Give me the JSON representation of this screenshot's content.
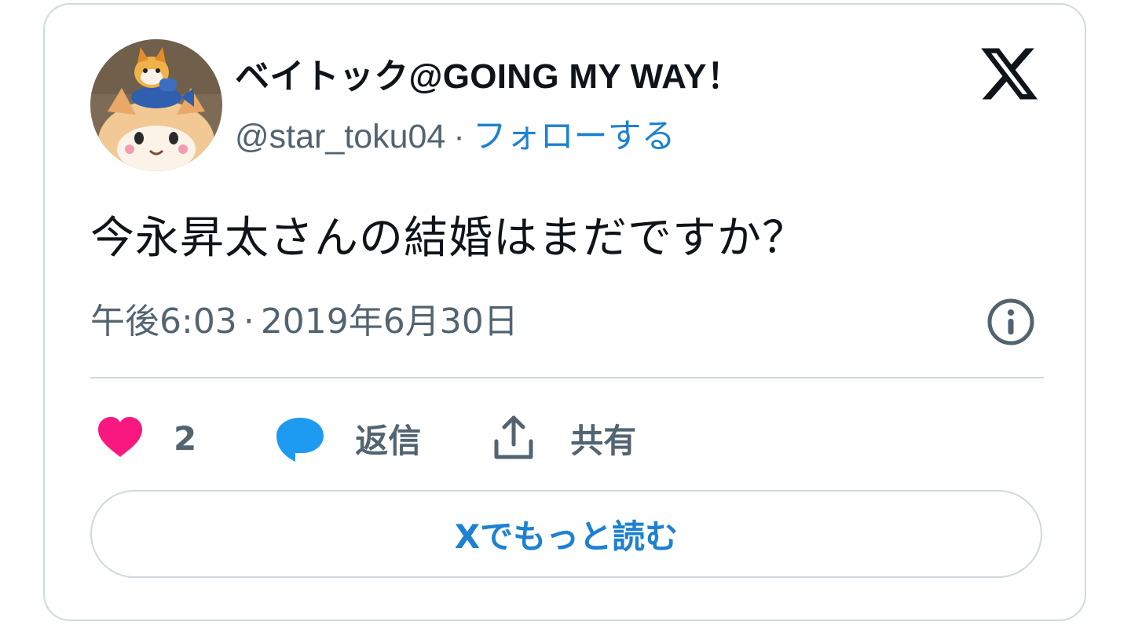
{
  "author": {
    "display_name": "ベイトック@GOING MY WAY！",
    "handle": "@star_toku04",
    "separator": "·",
    "follow_label": "フォローする",
    "avatar_icon": "mascot-avatar"
  },
  "brand": {
    "logo_icon": "x-logo-icon"
  },
  "tweet": {
    "text": "今永昇太さんの結婚はまだですか？",
    "time": "午後6:03",
    "separator": "·",
    "date": "2019年6月30日"
  },
  "actions": {
    "like_count": "2",
    "reply_label": "返信",
    "share_label": "共有"
  },
  "footer": {
    "read_more_label": "Xでもっと読む"
  },
  "colors": {
    "accent": "#1d81d1",
    "like": "#f91880",
    "reply": "#1d9bf0",
    "muted": "#536471",
    "text": "#0f1419",
    "border": "#cfd9de"
  }
}
